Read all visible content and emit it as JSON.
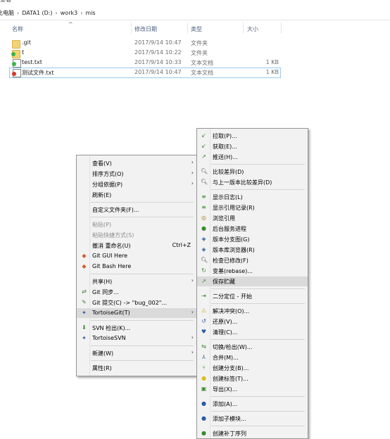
{
  "window": {
    "partial_title": "查看",
    "breadcrumb": [
      "此电脑",
      "DATA1 (D:)",
      "work3",
      "mis"
    ],
    "breadcrumb_sep": "›"
  },
  "columns": {
    "name": "名称",
    "date": "修改日期",
    "type": "类型",
    "size": "大小",
    "sort_indicator": "^"
  },
  "files": [
    {
      "name": ".git",
      "date": "2017/9/14 10:47",
      "type": "文件夹",
      "size": "",
      "icon": "folder-icon"
    },
    {
      "name": "t",
      "date": "2017/9/14 10:22",
      "type": "文件夹",
      "size": "",
      "icon": "folder-git-ok-icon"
    },
    {
      "name": "test.txt",
      "date": "2017/9/14 10:33",
      "type": "文本文档",
      "size": "1 KB",
      "icon": "text-file-git-ok-icon"
    },
    {
      "name": "测试文件.txt",
      "date": "2017/9/14 10:47",
      "type": "文本文档",
      "size": "1 KB",
      "icon": "text-file-git-modified-icon"
    }
  ],
  "context_menu": {
    "items": [
      {
        "label": "查看(V)",
        "submenu": true
      },
      {
        "label": "排序方式(O)",
        "submenu": true
      },
      {
        "label": "分组依据(P)",
        "submenu": true
      },
      {
        "label": "刷新(E)"
      },
      {
        "label": "自定义文件夹(F)..."
      },
      {
        "label": "粘贴(P)",
        "disabled": true
      },
      {
        "label": "粘贴快捷方式(S)",
        "disabled": true
      },
      {
        "label": "撤消 重命名(U)",
        "shortcut": "Ctrl+Z"
      },
      {
        "label": "Git GUI Here",
        "icon": "git-gui-icon"
      },
      {
        "label": "Git Bash Here",
        "icon": "git-bash-icon"
      },
      {
        "label": "共享(H)",
        "submenu": true
      },
      {
        "label": "Git 同步...",
        "icon": "git-sync-icon"
      },
      {
        "label": "Git 提交(C) -> \"bug_002\"...",
        "icon": "git-commit-icon"
      },
      {
        "label": "TortoiseGit(T)",
        "submenu": true,
        "icon": "tortoisegit-icon",
        "highlighted": true
      },
      {
        "label": "SVN 检出(K)...",
        "icon": "svn-checkout-icon"
      },
      {
        "label": "TortoiseSVN",
        "submenu": true,
        "icon": "tortoisesvn-icon"
      },
      {
        "label": "新建(W)",
        "submenu": true
      },
      {
        "label": "属性(R)"
      }
    ]
  },
  "tortoisegit_submenu": {
    "items": [
      {
        "label": "拉取(P)...",
        "icon": "pull-icon"
      },
      {
        "label": "获取(E)...",
        "icon": "fetch-icon"
      },
      {
        "label": "推送(H)...",
        "icon": "push-icon"
      },
      {
        "label": "比较差异(D)",
        "icon": "diff-icon"
      },
      {
        "label": "与上一版本比较差异(D)",
        "icon": "diff-prev-icon"
      },
      {
        "label": "显示日志(L)",
        "icon": "log-icon"
      },
      {
        "label": "显示引用记录(R)",
        "icon": "reflog-icon"
      },
      {
        "label": "浏览引用",
        "icon": "browse-refs-icon"
      },
      {
        "label": "后台服务进程",
        "icon": "daemon-icon"
      },
      {
        "label": "版本分支图(G)",
        "icon": "revision-graph-icon"
      },
      {
        "label": "版本库浏览器(R)",
        "icon": "repo-browser-icon"
      },
      {
        "label": "检查已修改(F)",
        "icon": "check-modified-icon"
      },
      {
        "label": "变基(rebase)...",
        "icon": "rebase-icon"
      },
      {
        "label": "保存贮藏",
        "icon": "stash-save-icon",
        "highlighted": true
      },
      {
        "label": "二分定位 - 开始",
        "icon": "bisect-icon"
      },
      {
        "label": "解决冲突(O)...",
        "icon": "resolve-icon"
      },
      {
        "label": "还原(V)...",
        "icon": "revert-icon"
      },
      {
        "label": "清理(C)...",
        "icon": "cleanup-icon"
      },
      {
        "label": "切换/检出(W)...",
        "icon": "switch-checkout-icon"
      },
      {
        "label": "合并(M)...",
        "icon": "merge-icon"
      },
      {
        "label": "创建分支(B)...",
        "icon": "create-branch-icon"
      },
      {
        "label": "创建标签(T)...",
        "icon": "create-tag-icon"
      },
      {
        "label": "导出(X)...",
        "icon": "export-icon"
      },
      {
        "label": "添加(A)...",
        "icon": "add-icon"
      },
      {
        "label": "添加子模块...",
        "icon": "add-submodule-icon"
      },
      {
        "label": "创建补丁序列",
        "icon": "create-patch-icon"
      }
    ]
  },
  "colors": {
    "menu_bg": "#f2f2f2",
    "highlight": "#dadada",
    "selection_border": "#99c9ef",
    "header_text": "#4d6082"
  }
}
